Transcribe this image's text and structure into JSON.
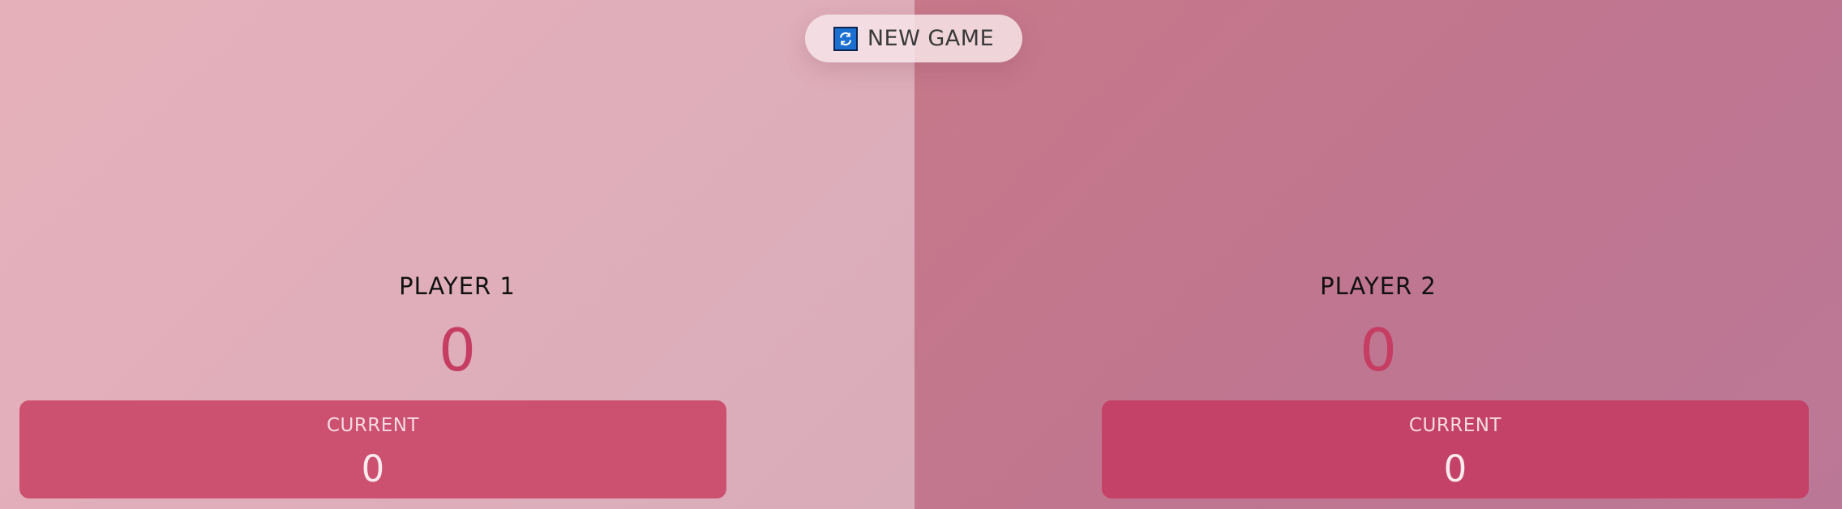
{
  "controls": {
    "new_game_label": "NEW GAME",
    "new_game_icon": "refresh-icon"
  },
  "players": [
    {
      "name": "PLAYER 1",
      "score": "0",
      "current_label": "CURRENT",
      "current_score": "0",
      "active": false
    },
    {
      "name": "PLAYER 2",
      "score": "0",
      "current_label": "CURRENT",
      "current_score": "0",
      "active": true
    }
  ],
  "colors": {
    "score": "#c63d63",
    "current_panel_player1": "#cc506f",
    "current_panel_player2": "#c44167",
    "icon_blue": "#1a6fd1"
  }
}
